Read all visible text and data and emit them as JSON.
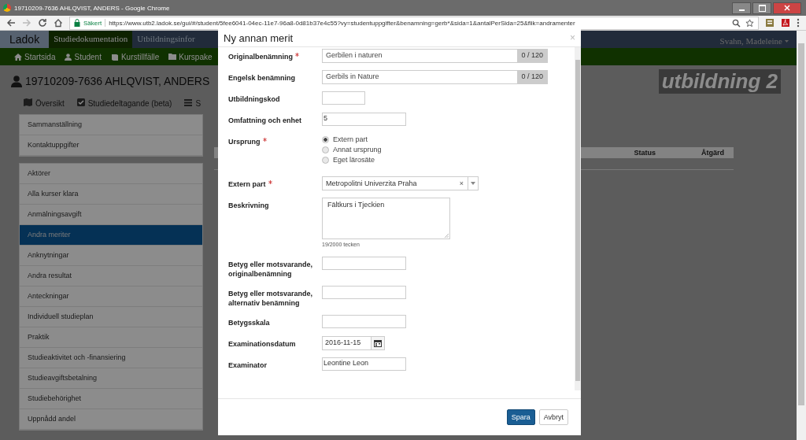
{
  "browser": {
    "title": "19710209-7636 AHLQVIST, ANDERS - Google Chrome",
    "secure_label": "Säkert",
    "url": "https://www.utb2.ladok.se/gui/#/student/5fee6041-04ec-11e7-96a8-0d81b37e4c55?vy=studentuppgifter&benamning=gerb*&sida=1&antalPerSida=25&flik=andramenter"
  },
  "topnav": {
    "logo": "Ladok",
    "tabs": [
      {
        "label": "Studiedokumentation",
        "selected": true
      },
      {
        "label": "Utbildningsinfor",
        "selected": false
      }
    ],
    "user": "Svahn, Madeleine"
  },
  "mainnav": [
    "Startsida",
    "Student",
    "Kurstillfälle",
    "Kurspake"
  ],
  "student": {
    "heading": "19710209-7636 AHLQVIST, ANDERS",
    "environment": "utbildning 2",
    "tabs": [
      "Översikt",
      "Studiedeltagande (beta)",
      "S"
    ]
  },
  "sidebar": {
    "groups": [
      [
        {
          "label": "Sammanställning",
          "selected": false
        },
        {
          "label": "Kontaktuppgifter",
          "selected": false
        }
      ],
      [
        {
          "label": "Aktörer",
          "selected": false
        },
        {
          "label": "Alla kurser klara",
          "selected": false
        },
        {
          "label": "Anmälningsavgift",
          "selected": false
        },
        {
          "label": "Andra meriter",
          "selected": true
        },
        {
          "label": "Anknytningar",
          "selected": false
        },
        {
          "label": "Andra resultat",
          "selected": false
        },
        {
          "label": "Anteckningar",
          "selected": false
        },
        {
          "label": "Individuell studieplan",
          "selected": false
        },
        {
          "label": "Praktik",
          "selected": false
        },
        {
          "label": "Studieaktivitet och -finansiering",
          "selected": false
        },
        {
          "label": "Studieavgiftsbetalning",
          "selected": false
        },
        {
          "label": "Studiebehörighet",
          "selected": false
        },
        {
          "label": "Uppnådd andel",
          "selected": false
        }
      ]
    ]
  },
  "content": {
    "columns": [
      "Status",
      "Åtgärd"
    ]
  },
  "modal": {
    "title": "Ny annan merit",
    "close": "×",
    "fields": [
      {
        "kind": "counter",
        "label": "Originalbenämning",
        "required": true,
        "value": "Gerbilen i naturen",
        "counter": "0 / 120"
      },
      {
        "kind": "counter",
        "label": "Engelsk benämning",
        "required": false,
        "value": "Gerbils in Nature",
        "counter": "0 / 120"
      },
      {
        "kind": "input",
        "label": "Utbildningskod",
        "required": false
      },
      {
        "kind": "input",
        "label": "Omfattning och enhet",
        "required": false,
        "value": "5"
      },
      {
        "kind": "radio",
        "label": "Ursprung",
        "required": true,
        "options": [
          {
            "label": "Extern part",
            "selected": true
          },
          {
            "label": "Annat ursprung",
            "selected": false
          },
          {
            "label": "Eget lärosäte",
            "selected": false
          }
        ]
      },
      {
        "kind": "select",
        "label": "Extern part",
        "required": true,
        "value": "Metropolitni Univerzita Praha",
        "clear": "×"
      },
      {
        "kind": "textarea",
        "label": "Beskrivning",
        "required": false,
        "value": "Fältkurs i Tjeckien",
        "hint": "19/2000 tecken"
      },
      {
        "kind": "input",
        "label": "Betyg eller motsvarande, originalbenämning",
        "required": false
      },
      {
        "kind": "input",
        "label": "Betyg eller motsvarande, alternativ benämning",
        "required": false
      },
      {
        "kind": "input",
        "label": "Betygsskala",
        "required": false
      },
      {
        "kind": "date",
        "label": "Examinationsdatum",
        "required": false,
        "value": "2016-11-15"
      },
      {
        "kind": "input",
        "label": "Examinator",
        "required": false,
        "value": "Leontine Leon"
      }
    ],
    "buttons": [
      {
        "label": "Spara",
        "primary": true
      },
      {
        "label": "Avbryt",
        "primary": false
      }
    ]
  }
}
